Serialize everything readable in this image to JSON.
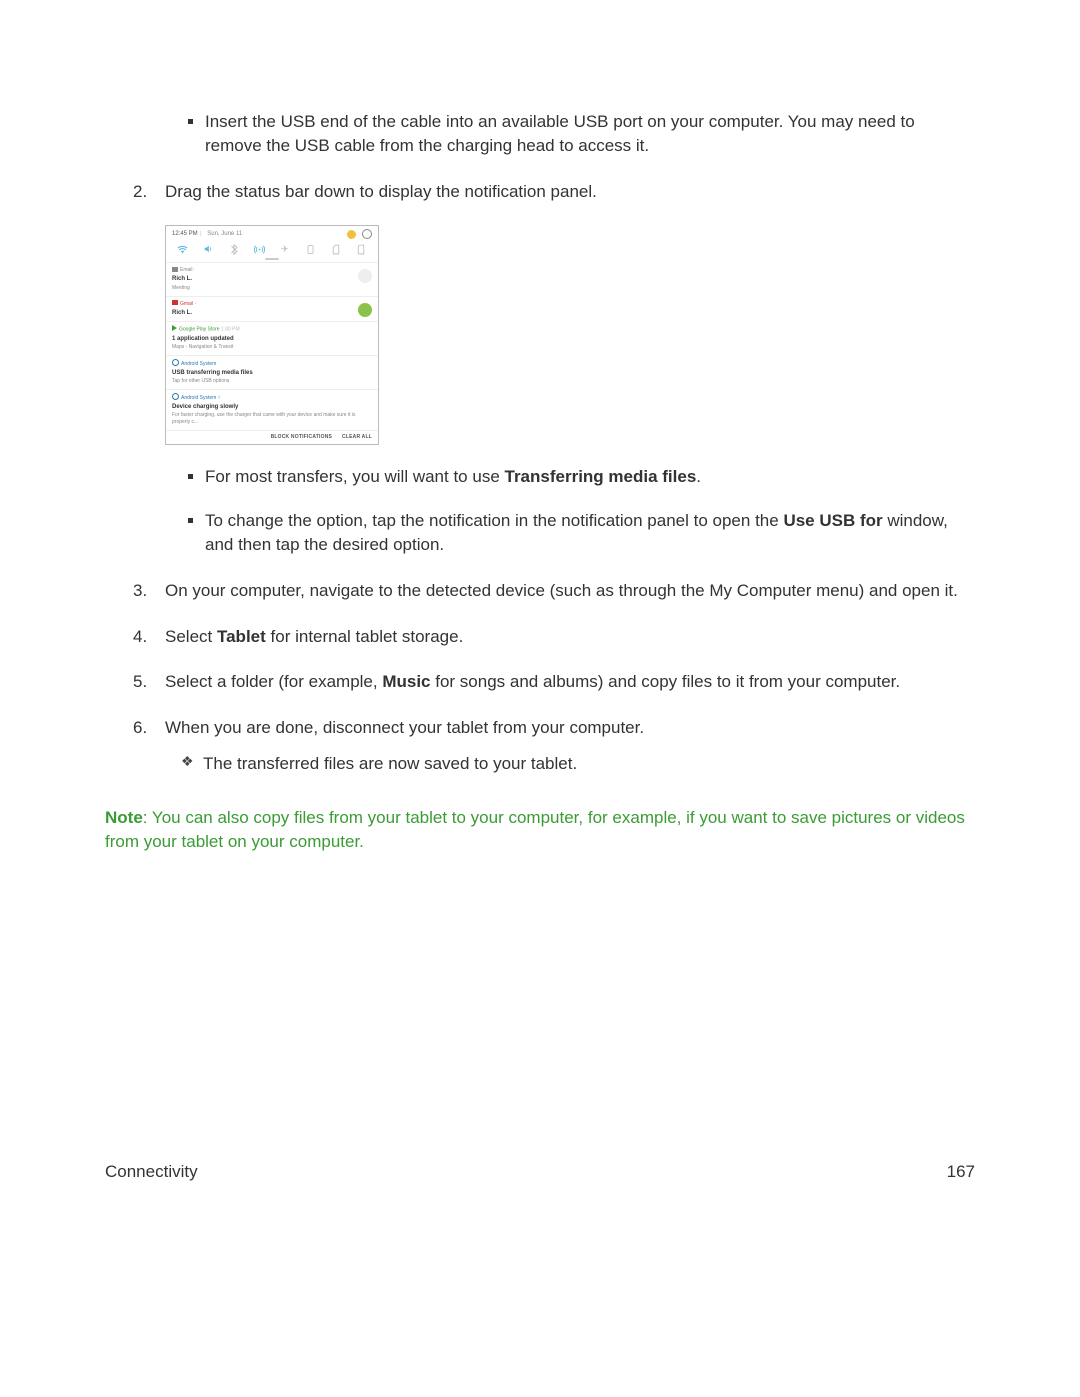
{
  "body": {
    "bullets_top": [
      "Insert the USB end of the cable into an available USB port on your computer. You may need to remove the USB cable from the charging head to access it."
    ],
    "step2": "Drag the status bar down to display the notification panel.",
    "bullets_mid": [
      {
        "pre": "For most transfers, you will want to use ",
        "bold": "Transferring media files",
        "post": "."
      },
      {
        "pre": "To change the option, tap the notification in the notification panel to open the ",
        "bold": "Use USB for",
        "post": " window, and then tap the desired option."
      }
    ],
    "step3": "On your computer, navigate to the detected device (such as through the My Computer menu) and open it.",
    "step4_pre": "Select ",
    "step4_bold": "Tablet",
    "step4_post": " for internal tablet storage.",
    "step5_pre": "Select a folder (for example, ",
    "step5_bold": "Music",
    "step5_post": " for songs and albums) and copy files to it from your computer.",
    "step6": "When you are done, disconnect your tablet from your computer.",
    "step6_sub": "The transferred files are now saved to your tablet."
  },
  "note": {
    "label": "Note",
    "text": ": You can also copy files from your tablet to your computer, for example, if you want to save pictures or videos from your tablet on your computer."
  },
  "footer": {
    "section": "Connectivity",
    "page": "167"
  },
  "np": {
    "time": "12:45 PM",
    "date": "Sun, June 11",
    "items": [
      {
        "app": "Email",
        "appClass": "",
        "iconClass": "email",
        "title": "Rich L.",
        "sub": "Meeting",
        "avatar": "grey"
      },
      {
        "app": "Gmail",
        "appClass": "red",
        "iconClass": "gmail",
        "title": "Rich L.",
        "sub": "",
        "avatar": "green"
      },
      {
        "app": "Google Play Store",
        "time": "1:40 PM",
        "appClass": "green",
        "iconClass": "play",
        "title": "1 application updated",
        "sub": "Maps - Navigation & Transit"
      },
      {
        "app": "Android System",
        "appClass": "blue",
        "iconClass": "info",
        "title": "USB transferring media files",
        "sub": "Tap for other USB options."
      },
      {
        "app": "Android System",
        "chevron": true,
        "appClass": "blue",
        "iconClass": "info",
        "title": "Device charging slowly",
        "sub": "For faster charging, use the charger that came with your device and make sure it is properly c..."
      }
    ],
    "actions": [
      "BLOCK NOTIFICATIONS",
      "CLEAR ALL"
    ]
  }
}
